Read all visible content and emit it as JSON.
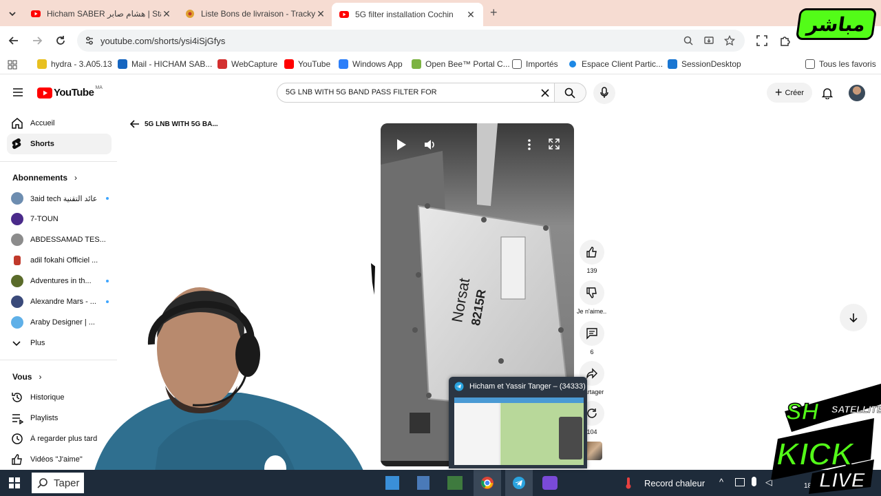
{
  "browser": {
    "tabs": [
      {
        "title": "Hicham SABER هشام صابر | Star",
        "icon_color": "#ff0000",
        "active": false
      },
      {
        "title": "Liste Bons de livraison - Tracky",
        "icon_color": "#e0a030",
        "active": false
      },
      {
        "title": "5G filter installation Cochin",
        "icon_color": "#ff0000",
        "active": true
      }
    ],
    "new_tab_symbol": "+",
    "url": "youtube.com/shorts/ysi4iSjGfys",
    "bookmarks": [
      {
        "label": "hydra - 3.A05.13",
        "icon_color": "#e8c020"
      },
      {
        "label": "Mail - HICHAM SAB...",
        "icon_color": "#1565c0"
      },
      {
        "label": "WebCapture",
        "icon_color": "#d32f2f"
      },
      {
        "label": "YouTube",
        "icon_color": "#ff0000"
      },
      {
        "label": "Windows App",
        "icon_color": "#2d7ff9"
      },
      {
        "label": "Open Bee™ Portal C...",
        "icon_color": "#7cb342"
      },
      {
        "label": "Importés",
        "icon_color": "#555555"
      },
      {
        "label": "Espace Client Partic...",
        "icon_color": "#1e88e5"
      },
      {
        "label": "SessionDesktop",
        "icon_color": "#1976d2"
      }
    ],
    "all_favorites": "Tous les favoris"
  },
  "youtube": {
    "logo_text": "YouTube",
    "region": "MA",
    "search_value": "5G LNB WITH 5G BAND PASS FILTER FOR",
    "create_label": "Créer",
    "back_title": "5G LNB WITH 5G BA...",
    "sidebar": {
      "main": [
        {
          "label": "Accueil",
          "icon": "home-icon"
        },
        {
          "label": "Shorts",
          "icon": "shorts-icon"
        }
      ],
      "subscriptions_title": "Abonnements",
      "subscriptions": [
        {
          "label": "3aid tech عائد التقنية",
          "color": "#6d8db0",
          "dot": true
        },
        {
          "label": "7-TOUN",
          "color": "#4a2a8a",
          "dot": false
        },
        {
          "label": "ABDESSAMAD TES...",
          "color": "#8c8c8c",
          "dot": false
        },
        {
          "label": "adil fokahi Officiel ...",
          "color": "#c0392b",
          "dot": false
        },
        {
          "label": "Adventures in th...",
          "color": "#5a6b2a",
          "dot": true
        },
        {
          "label": "Alexandre Mars - ...",
          "color": "#3a4a7a",
          "dot": true
        },
        {
          "label": "Araby Designer | ...",
          "color": "#5fb0e8",
          "dot": false
        }
      ],
      "more_label": "Plus",
      "you_title": "Vous",
      "you": [
        {
          "label": "Historique",
          "icon": "history-icon"
        },
        {
          "label": "Playlists",
          "icon": "playlists-icon"
        },
        {
          "label": "À regarder plus tard",
          "icon": "watch-later-icon"
        },
        {
          "label": "Vidéos \"J'aime\"",
          "icon": "liked-icon"
        }
      ]
    },
    "short": {
      "like_count": "139",
      "dislike_label": "Je n'aime...",
      "comment_count": "6",
      "share_label": "Partager",
      "remix_count": "104",
      "label_text": "Norsat",
      "model_text": "8215R"
    }
  },
  "taskbar": {
    "search_placeholder": "Taper",
    "weather_text": "Record chaleur",
    "clock_fragment": "18"
  },
  "telegram_popup": {
    "title": "Hicham et Yassir Tanger – (34333)"
  },
  "overlays": {
    "mubashir_badge": "مباشر",
    "kick_brand": "SH",
    "kick_sub": "SATELLITE",
    "kick_word": "KICK",
    "live_word": "LIVE"
  },
  "colors": {
    "youtube_red": "#ff0000",
    "kick_green": "#53fc18",
    "tab_strip": "#f6dcd2"
  }
}
